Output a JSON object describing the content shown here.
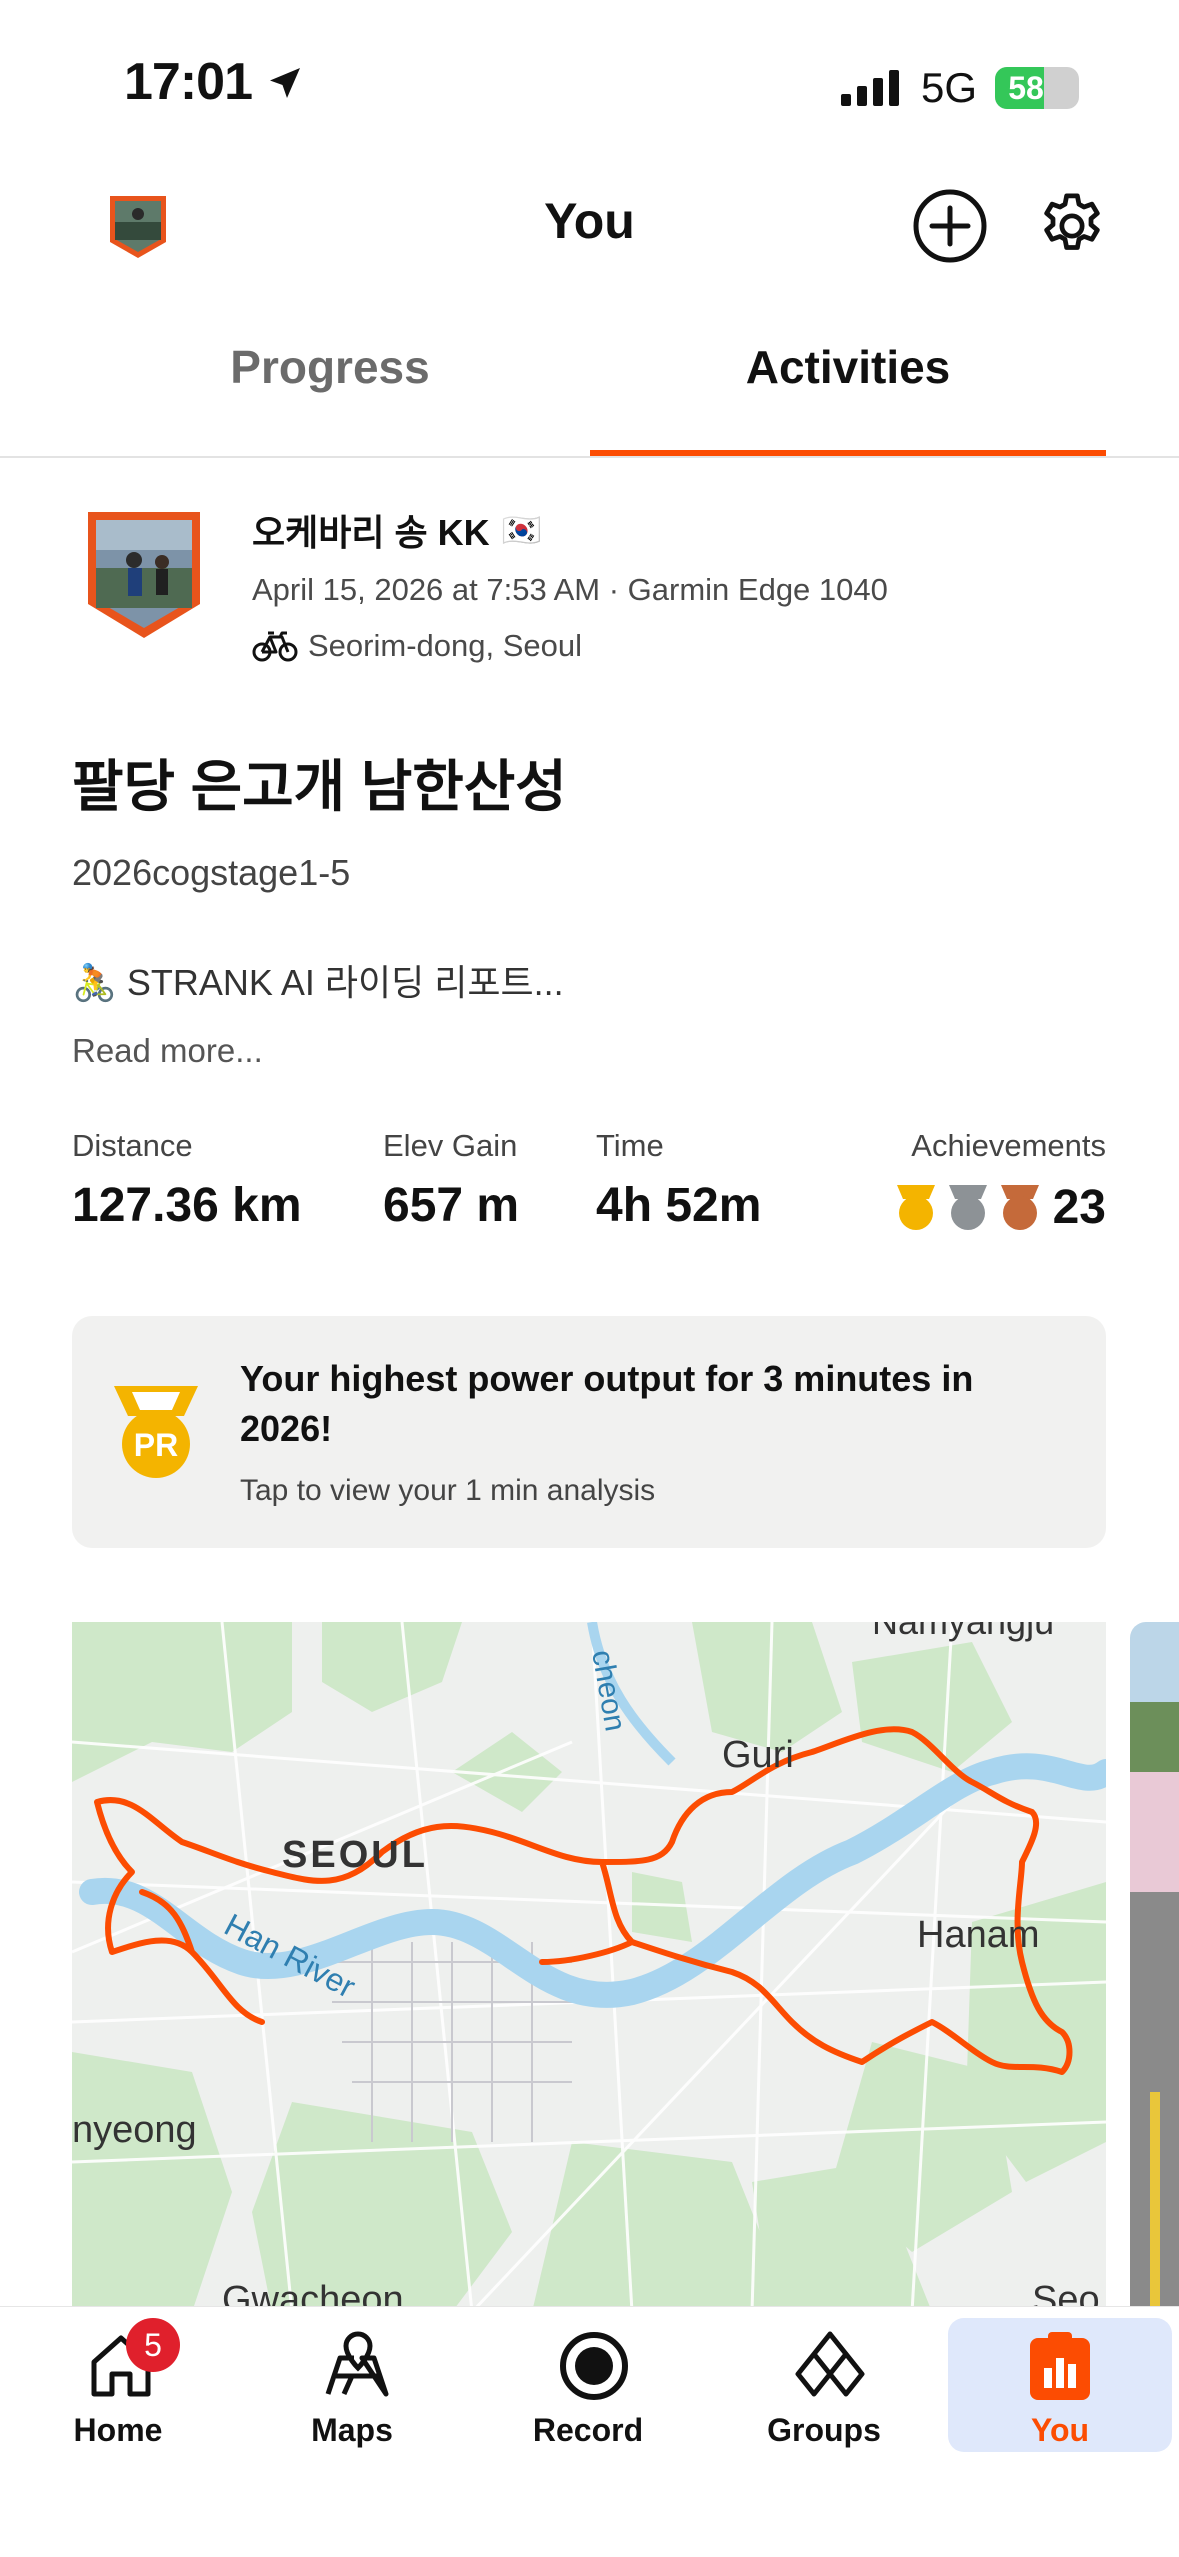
{
  "status": {
    "time": "17:01",
    "network": "5G",
    "battery": "58",
    "battery_level": 0.58
  },
  "header": {
    "title": "You"
  },
  "tabs": [
    {
      "label": "Progress"
    },
    {
      "label": "Activities"
    }
  ],
  "activity": {
    "athlete_name": "오케바리 송 KK",
    "flag": "🇰🇷",
    "date_device": "April 15, 2026 at 7:53 AM · Garmin Edge 1040",
    "location": "Seorim-dong, Seoul",
    "title": "팔당 은고개 남한산성",
    "tag": "2026cogstage1-5",
    "description": "🚴 STRANK AI 라이딩 리포트...",
    "read_more": "Read more...",
    "stats": {
      "distance_label": "Distance",
      "distance_value": "127.36 km",
      "elev_label": "Elev Gain",
      "elev_value": "657 m",
      "time_label": "Time",
      "time_value": "4h 52m",
      "achievements_label": "Achievements",
      "achievements_value": "23"
    },
    "pr_card": {
      "badge": "PR",
      "title": "Your highest power output for 3 minutes in 2026!",
      "subtitle": "Tap to view your 1 min analysis"
    },
    "map_labels": {
      "seoul": "SEOUL",
      "guri": "Guri",
      "hanam": "Hanam",
      "han_river": "Han River",
      "namyangju": "Namyangju",
      "gwangmyeong": "nyeong",
      "jungnang": "cheon",
      "gwacheon": "Gwacheon",
      "seongnam": "Seo"
    },
    "route_color": "#fc4c02"
  },
  "nav": {
    "home": "Home",
    "home_badge": "5",
    "maps": "Maps",
    "record": "Record",
    "groups": "Groups",
    "you": "You"
  },
  "colors": {
    "accent": "#fc4c02",
    "gold": "#f4b400",
    "silver": "#8d9296",
    "bronze": "#c56a3a"
  }
}
